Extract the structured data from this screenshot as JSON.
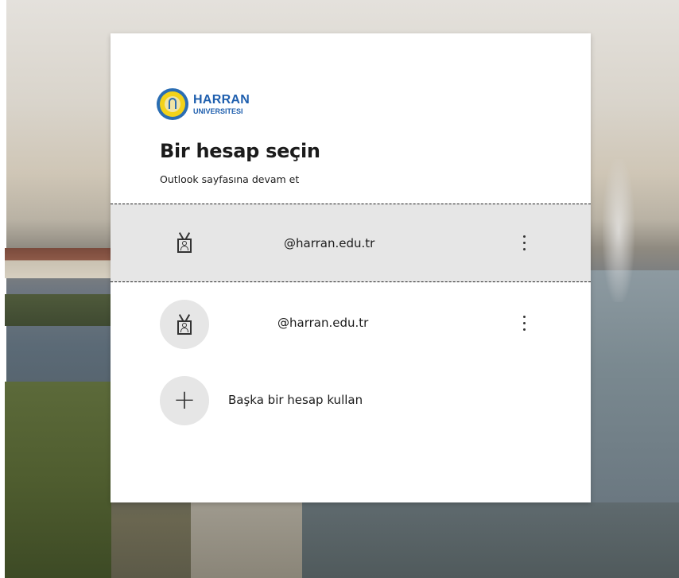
{
  "brand": {
    "name_line1": "HARRAN",
    "name_line2": "UNIVERSITESI",
    "seal_text": "HARRAN UNIVERSITESI"
  },
  "dialog": {
    "title": "Bir hesap seçin",
    "subtitle": "Outlook sayfasına devam et"
  },
  "accounts": [
    {
      "email": "@harran.edu.tr",
      "selected": true,
      "icon": "badge-icon",
      "more_icon": "more-options-icon"
    },
    {
      "email": "@harran.edu.tr",
      "selected": false,
      "icon": "badge-icon",
      "more_icon": "more-options-icon"
    }
  ],
  "add_account": {
    "label": "Başka bir hesap kullan",
    "icon": "plus-icon"
  },
  "colors": {
    "brand_blue": "#1f5fae",
    "seal_yellow": "#f2d21a",
    "selected_row_bg": "#e6e6e6",
    "text": "#1b1b1b"
  }
}
